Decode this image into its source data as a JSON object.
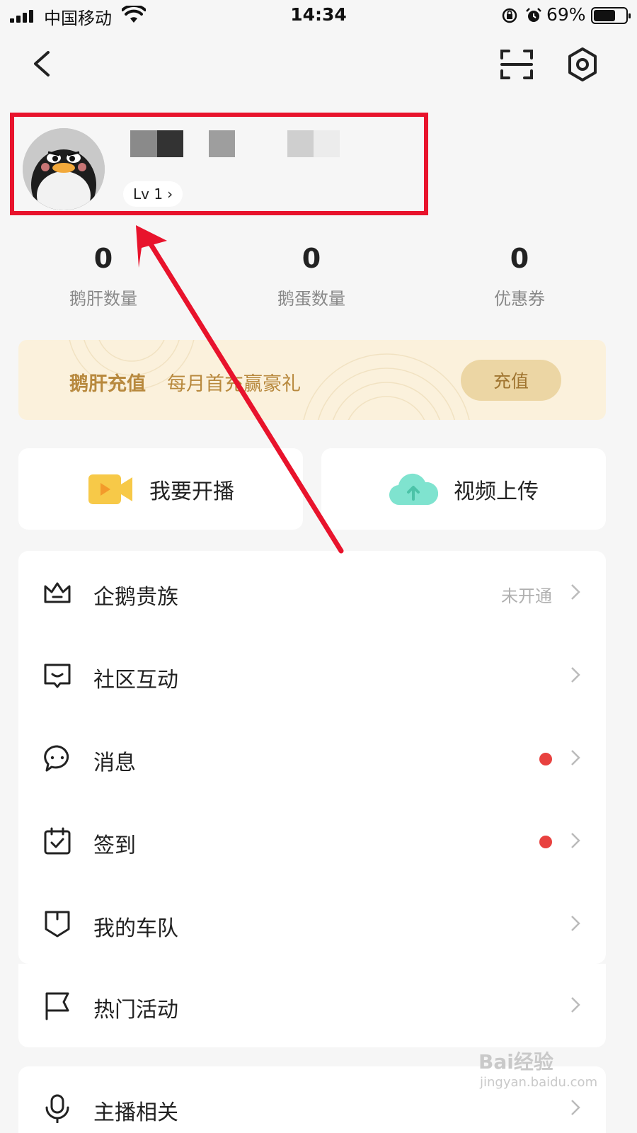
{
  "status_bar": {
    "carrier": "中国移动",
    "time": "14:34",
    "battery": "69%",
    "battery_level": 0.69
  },
  "header": {
    "back_icon": "chevron-left-icon",
    "scan_icon": "scan-icon",
    "settings_icon": "gear-icon"
  },
  "profile": {
    "level": "Lv 1",
    "level_chevron": "›"
  },
  "stats": [
    {
      "value": "0",
      "label": "鹅肝数量"
    },
    {
      "value": "0",
      "label": "鹅蛋数量"
    },
    {
      "value": "0",
      "label": "优惠券"
    }
  ],
  "banner": {
    "title": "鹅肝充值",
    "subtitle": "每月首充赢豪礼",
    "button": "充值"
  },
  "actions": [
    {
      "label": "我要开播",
      "icon": "video-camera-icon"
    },
    {
      "label": "视频上传",
      "icon": "cloud-upload-icon"
    }
  ],
  "menu": [
    {
      "label": "企鹅贵族",
      "status": "未开通",
      "icon": "crown-icon"
    },
    {
      "label": "社区互动",
      "icon": "chat-square-icon"
    },
    {
      "label": "消息",
      "icon": "message-bubble-icon",
      "badge": true
    },
    {
      "label": "签到",
      "icon": "calendar-check-icon",
      "badge": true
    },
    {
      "label": "我的车队",
      "icon": "shield-icon"
    },
    {
      "label": "热门活动",
      "icon": "flag-icon"
    },
    {
      "label": "主播相关",
      "icon": "microphone-icon"
    }
  ],
  "colors": {
    "accent_red": "#e8132c",
    "badge_red": "#e8413f",
    "gold": "#b8893e"
  },
  "watermark": {
    "brand": "Bai经验",
    "url": "jingyan.baidu.com"
  }
}
